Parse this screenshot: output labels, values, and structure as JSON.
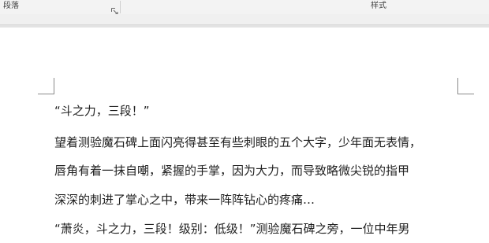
{
  "ribbon": {
    "paragraph_group_label": "段落",
    "styles_group_label": "样式"
  },
  "document": {
    "lines": [
      "“斗之力，三段！”",
      "望着测验魔石碑上面闪亮得甚至有些刺眼的五个大字，少年面无表情，",
      "唇角有着一抹自嘲，紧握的手掌，因为大力，而导致略微尖锐的指甲",
      "深深的刺进了掌心之中，带来一阵阵钻心的疼痛…",
      "“萧炎，斗之力，三段！级别：低级！”测验魔石碑之旁，一位中年男"
    ]
  },
  "icons": {
    "dialog_launcher": "dialog-launcher-icon"
  },
  "colors": {
    "ribbon_bg": "#f3f3f3",
    "page_bg": "#ffffff",
    "text": "#1f1f1f",
    "crop_marks": "#8a8a8a"
  }
}
